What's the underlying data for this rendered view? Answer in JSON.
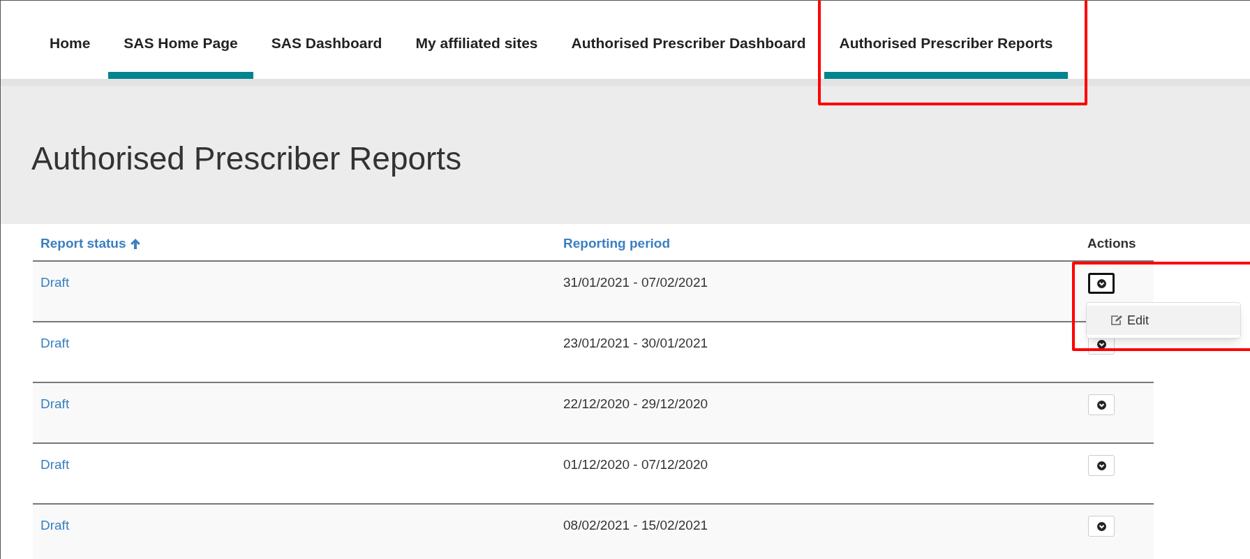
{
  "tabs": [
    {
      "label": "Home",
      "selected": false,
      "highlighted": false
    },
    {
      "label": "SAS Home Page",
      "selected": true,
      "highlighted": false
    },
    {
      "label": "SAS Dashboard",
      "selected": false,
      "highlighted": false
    },
    {
      "label": "My affiliated sites",
      "selected": false,
      "highlighted": false
    },
    {
      "label": "Authorised Prescriber Dashboard",
      "selected": false,
      "highlighted": false
    },
    {
      "label": "Authorised Prescriber Reports",
      "selected": true,
      "highlighted": true
    }
  ],
  "page_title": "Authorised Prescriber Reports",
  "table": {
    "columns": [
      {
        "label": "Report status",
        "sortable": true,
        "sorted_ascending": true
      },
      {
        "label": "Reporting period",
        "sortable": true,
        "sorted_ascending": false
      },
      {
        "label": "Actions",
        "sortable": false,
        "sorted_ascending": false
      }
    ],
    "rows": [
      {
        "status": "Draft",
        "period": "31/01/2021 - 07/02/2021",
        "menu_open": true,
        "highlighted": true,
        "menu_items": [
          "Edit"
        ]
      },
      {
        "status": "Draft",
        "period": "23/01/2021 - 30/01/2021",
        "menu_open": false,
        "highlighted": false
      },
      {
        "status": "Draft",
        "period": "22/12/2020 - 29/12/2020",
        "menu_open": false,
        "highlighted": false
      },
      {
        "status": "Draft",
        "period": "01/12/2020 - 07/12/2020",
        "menu_open": false,
        "highlighted": false
      },
      {
        "status": "Draft",
        "period": "08/02/2021 - 15/02/2021",
        "menu_open": false,
        "highlighted": false
      }
    ]
  }
}
